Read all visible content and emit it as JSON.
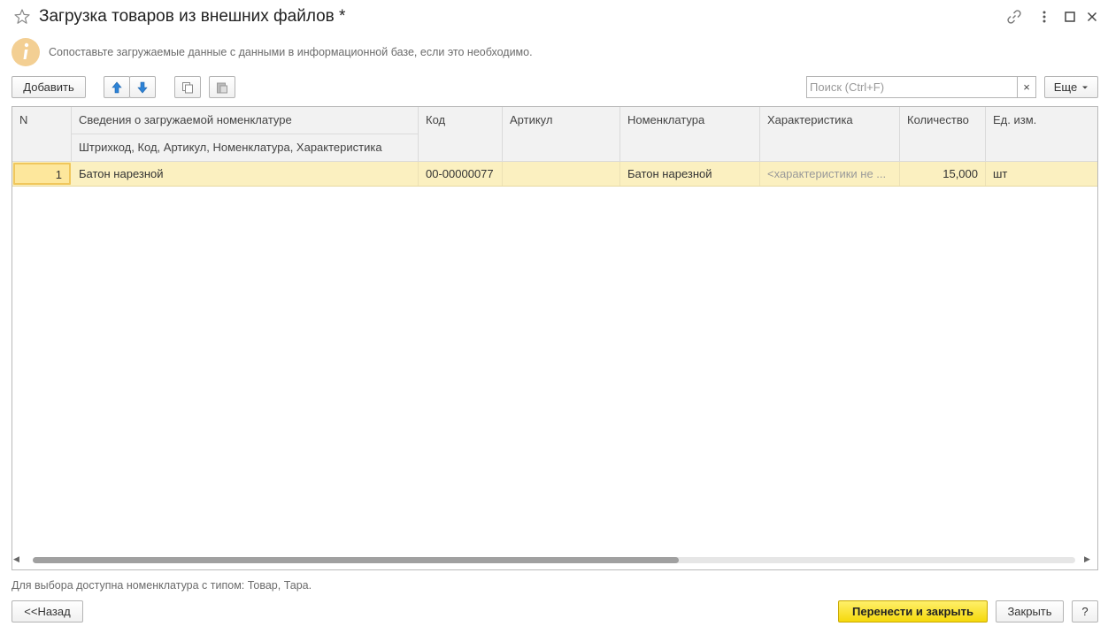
{
  "window": {
    "title": "Загрузка товаров из внешних файлов *"
  },
  "info": {
    "message": "Сопоставьте загружаемые данные с данными в информационной базе, если это необходимо."
  },
  "toolbar": {
    "add_label": "Добавить",
    "search_placeholder": "Поиск (Ctrl+F)",
    "clear_label": "×",
    "more_label": "Еще"
  },
  "table": {
    "headers": {
      "n": "N",
      "info": "Сведения о загружаемой номенклатуре",
      "info_sub": "Штрихкод, Код, Артикул, Номенклатура, Характеристика",
      "code": "Код",
      "article": "Артикул",
      "nomenclature": "Номенклатура",
      "characteristic": "Характеристика",
      "quantity": "Количество",
      "unit": "Ед. изм."
    },
    "rows": [
      {
        "n": "1",
        "info": "Батон нарезной",
        "code": "00-00000077",
        "article": "",
        "nomenclature": "Батон нарезной",
        "characteristic": "<характеристики не ...",
        "quantity": "15,000",
        "unit": "шт"
      }
    ]
  },
  "footer": {
    "note": "Для выбора доступна номенклатура с типом: Товар, Тара.",
    "back_label": "<<Назад",
    "transfer_label": "Перенести и закрыть",
    "close_label": "Закрыть",
    "help_label": "?"
  },
  "colors": {
    "selected_row": "#fbf0c0",
    "primary_button": "#f5d90c",
    "info_icon": "#f3cf93"
  }
}
